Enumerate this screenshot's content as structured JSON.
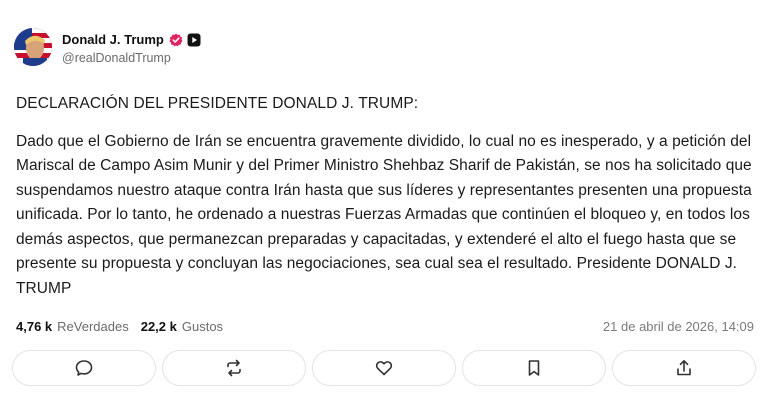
{
  "author": {
    "display_name": "Donald J. Trump",
    "handle": "@realDonaldTrump",
    "verified_icon": "verified-badge-icon",
    "platform_icon": "platform-play-icon",
    "badge_color": "#e0245e"
  },
  "post": {
    "title": "DECLARACIÓN DEL PRESIDENTE DONALD J. TRUMP:",
    "body": "Dado que el Gobierno de Irán se encuentra gravemente dividido, lo cual no es inesperado, y a petición del Mariscal de Campo Asim Munir y del Primer Ministro Shehbaz Sharif de Pakistán, se nos ha solicitado que suspendamos nuestro ataque contra Irán hasta que sus líderes y representantes presenten una propuesta unificada. Por lo tanto, he ordenado a nuestras Fuerzas Armadas que continúen el bloqueo y, en todos los demás aspectos, que permanezcan preparadas y capacitadas, y extenderé el alto el fuego hasta que se presente su propuesta y concluyan las negociaciones, sea cual sea el resultado. Presidente DONALD J. TRUMP"
  },
  "stats": {
    "retruths_count": "4,76 k",
    "retruths_label": "ReVerdades",
    "likes_count": "22,2 k",
    "likes_label": "Gustos",
    "timestamp": "21 de abril de 2026, 14:09"
  },
  "actions": [
    {
      "name": "reply",
      "icon": "reply-bubble-icon"
    },
    {
      "name": "retruth",
      "icon": "retruth-icon"
    },
    {
      "name": "like",
      "icon": "heart-icon"
    },
    {
      "name": "bookmark",
      "icon": "bookmark-icon"
    },
    {
      "name": "share",
      "icon": "share-icon"
    }
  ]
}
